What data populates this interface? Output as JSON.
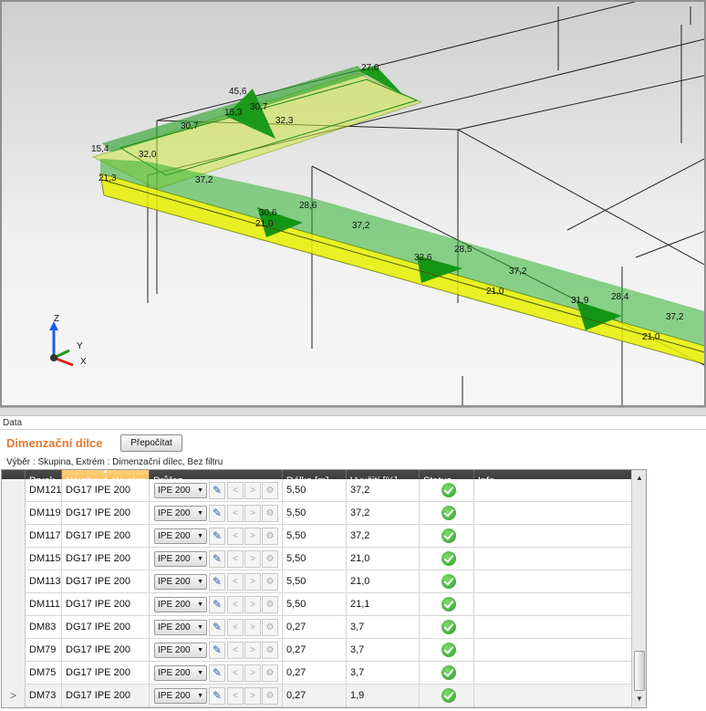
{
  "viewport": {
    "axes": {
      "z": "Z",
      "y": "Y",
      "x": "X"
    },
    "labels": [
      "27,0",
      "45,6",
      "30,7",
      "15,3",
      "32,3",
      "30,7",
      "15,4",
      "32,0",
      "21,3",
      "37,2",
      "30,6",
      "21,0",
      "28,6",
      "37,2",
      "32,6",
      "28,5",
      "37,2",
      "21,0",
      "31,9",
      "28,4",
      "37,2",
      "21,0"
    ]
  },
  "panel": {
    "label": "Data"
  },
  "dimensioning": {
    "title": "Dimenzační dílce",
    "recalc_label": "Přepočítat",
    "filter_text": "Výběr : Skupina, Extrém : Dimenzační dílec, Bez filtru"
  },
  "grid": {
    "columns": {
      "prvek": "Prvek",
      "skupina": "Návrhová skupina",
      "prurez": "Průřez",
      "delka": "Délka [m]",
      "vyuziti": "Využití [%]",
      "status": "Status",
      "info": "Info"
    },
    "rows": [
      {
        "prvek": "DM121",
        "skupina": "DG17 IPE 200",
        "prurez": "IPE 200",
        "delka": "5,50",
        "vyuziti": "37,2"
      },
      {
        "prvek": "DM119",
        "skupina": "DG17 IPE 200",
        "prurez": "IPE 200",
        "delka": "5,50",
        "vyuziti": "37,2"
      },
      {
        "prvek": "DM117",
        "skupina": "DG17 IPE 200",
        "prurez": "IPE 200",
        "delka": "5,50",
        "vyuziti": "37,2"
      },
      {
        "prvek": "DM115",
        "skupina": "DG17 IPE 200",
        "prurez": "IPE 200",
        "delka": "5,50",
        "vyuziti": "21,0"
      },
      {
        "prvek": "DM113",
        "skupina": "DG17 IPE 200",
        "prurez": "IPE 200",
        "delka": "5,50",
        "vyuziti": "21,0"
      },
      {
        "prvek": "DM111",
        "skupina": "DG17 IPE 200",
        "prurez": "IPE 200",
        "delka": "5,50",
        "vyuziti": "21,1"
      },
      {
        "prvek": "DM83",
        "skupina": "DG17 IPE 200",
        "prurez": "IPE 200",
        "delka": "0,27",
        "vyuziti": "3,7"
      },
      {
        "prvek": "DM79",
        "skupina": "DG17 IPE 200",
        "prurez": "IPE 200",
        "delka": "0,27",
        "vyuziti": "3,7"
      },
      {
        "prvek": "DM75",
        "skupina": "DG17 IPE 200",
        "prurez": "IPE 200",
        "delka": "0,27",
        "vyuziti": "3,7"
      },
      {
        "prvek": "DM73",
        "skupina": "DG17 IPE 200",
        "prurez": "IPE 200",
        "delka": "0,27",
        "vyuziti": "1,9"
      }
    ],
    "current_row_marker": ">",
    "row_buttons": {
      "prev": "<",
      "next": ">"
    },
    "status_color": "#2a9a2a",
    "status_icon": "check-circle-icon"
  },
  "colors": {
    "accent": "#e07a34",
    "beam": "#e8f000",
    "diagram": "#1f9a1f",
    "header": "#2f2f2f",
    "sorted_header": "#f0a53a"
  }
}
